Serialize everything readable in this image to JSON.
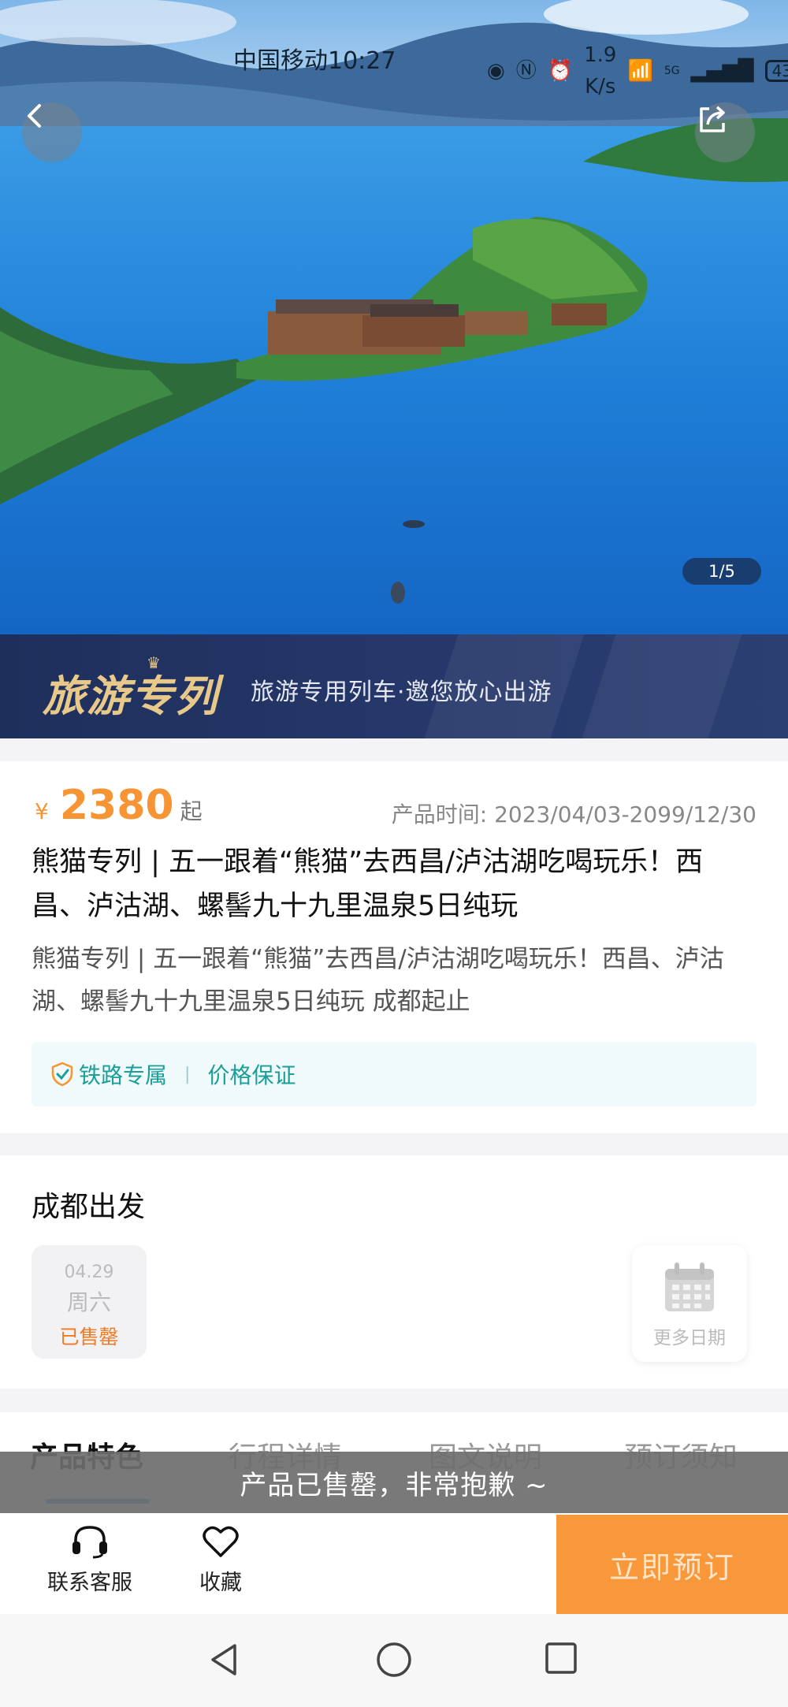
{
  "status_bar": {
    "carrier_time": "中国移动10:27",
    "net_speed_top": "1.9",
    "net_speed_unit": "K/s",
    "signal": "5G",
    "battery": "43"
  },
  "hero": {
    "image_counter": "1/5"
  },
  "banner": {
    "logo_text": "旅游专列",
    "slogan": "旅游专用列车·邀您放心出游"
  },
  "product": {
    "price_symbol": "¥",
    "price": "2380",
    "price_unit": "起",
    "time_label": "产品时间: 2023/04/03-2099/12/30",
    "title": "熊猫专列 | 五一跟着“熊猫”去西昌/泸沽湖吃喝玩乐！西昌、泸沽湖、螺髻九十九里温泉5日纯玩",
    "description": "熊猫专列 | 五一跟着“熊猫”去西昌/泸沽湖吃喝玩乐！西昌、泸沽湖、螺髻九十九里温泉5日纯玩 成都起止",
    "tags": [
      "铁路专属",
      "价格保证"
    ]
  },
  "departure": {
    "title": "成都出发",
    "date": {
      "md": "04.29",
      "weekday": "周六",
      "status": "已售罄"
    },
    "more_dates": "更多日期"
  },
  "tabs": [
    "产品特色",
    "行程详情",
    "图文说明",
    "预订须知"
  ],
  "toast": "产品已售罄，非常抱歉 ~",
  "action_bar": {
    "customer_service": "联系客服",
    "favorite": "收藏",
    "book": "立即预订"
  },
  "colors": {
    "price": "#f79433",
    "book_button": "#f8983a",
    "tag_text": "#1a9e9a",
    "tab_indicator": "#3a8bf0",
    "banner_bg": "#1e2f5c"
  }
}
